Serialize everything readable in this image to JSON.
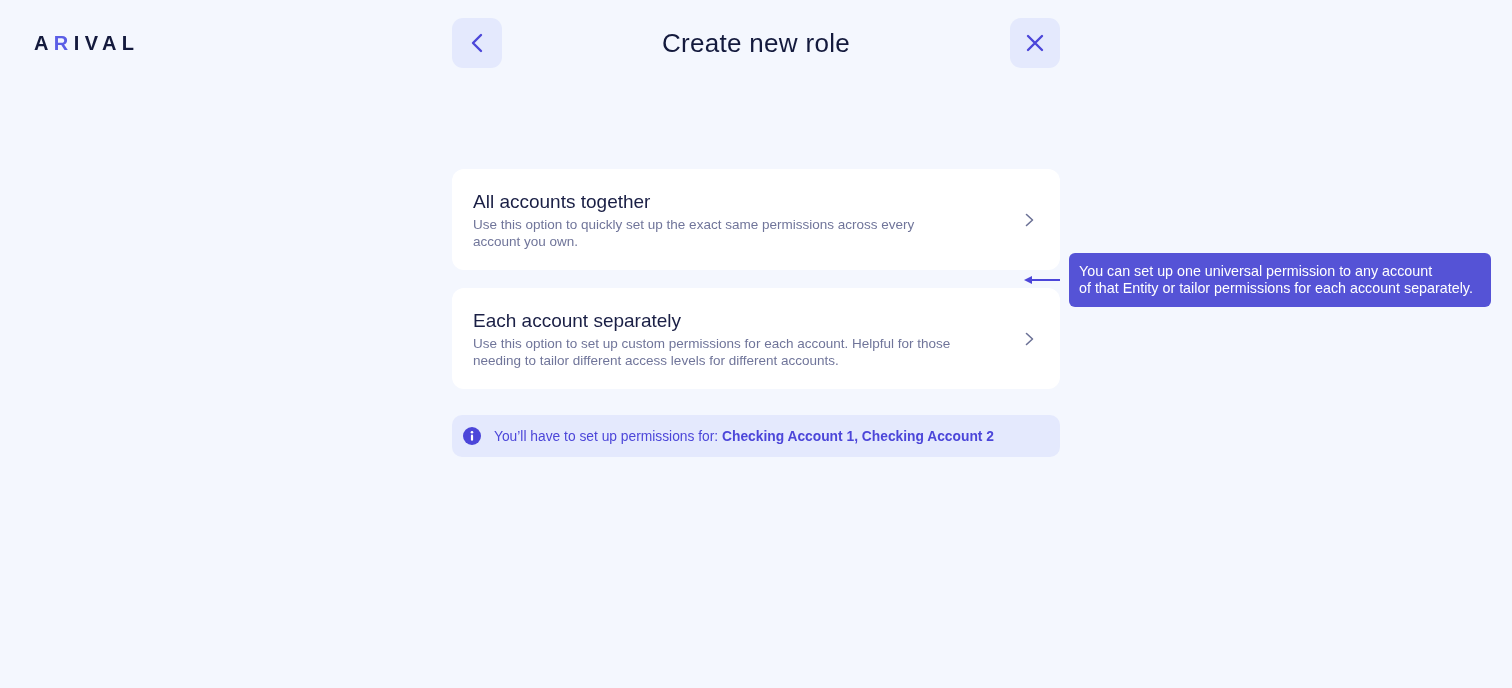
{
  "logo": {
    "text": "A**R**IVAL"
  },
  "header": {
    "title": "Create new role"
  },
  "options": [
    {
      "title": "All accounts together",
      "description": "Use this option to quickly set up the exact same permissions across every account you own."
    },
    {
      "title": "Each account separately",
      "description": "Use this option to set up custom permissions for each account. Helpful for those needing to tailor different access levels for different accounts."
    }
  ],
  "tooltip": {
    "text": "You can set up one universal permission to any account\nof that Entity or tailor permissions for each account separately."
  },
  "notice": {
    "text": "You’ll have to set up permissions for: **Checking Account 1, Checking Account 2**"
  }
}
